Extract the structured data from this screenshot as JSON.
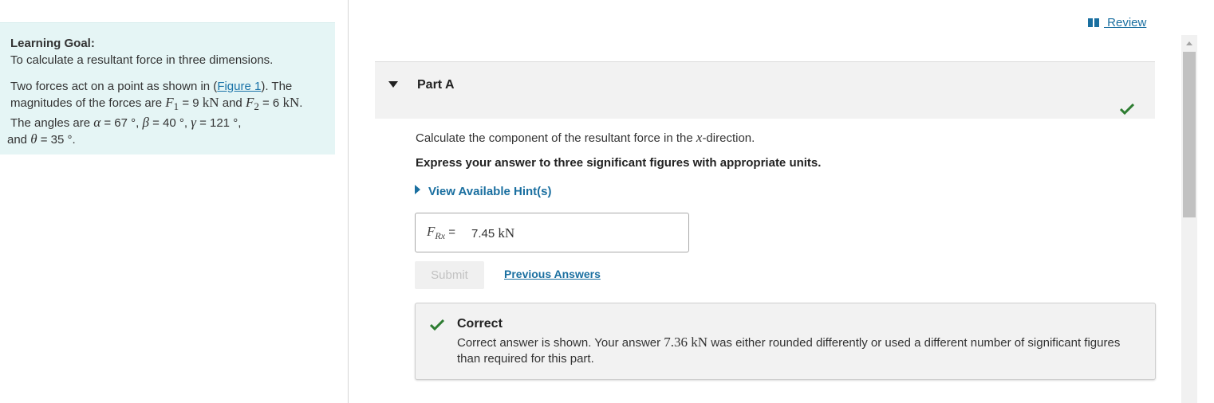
{
  "left": {
    "learning_goal_title": "Learning Goal:",
    "learning_goal_text": "To calculate a resultant force in three dimensions.",
    "problem": {
      "intro": "Two forces act on a point as shown in (",
      "figure_link": "Figure 1",
      "after_link": "). The magnitudes of the forces are ",
      "f1_sym": "F",
      "f1_sub": "1",
      "f1_eq": " = 9 ",
      "unit_kn": "kN",
      "and1": " and ",
      "f2_sym": "F",
      "f2_sub": "2",
      "f2_eq": " = 6 ",
      "unit_kn2": "kN",
      "angles_intro": ". The angles are  ",
      "alpha_sym": "α",
      "alpha_val": " = 67 °, ",
      "beta_sym": "β",
      "beta_val": " = 40 °, ",
      "gamma_sym": "γ",
      "gamma_val": " = 121 °,",
      "and2": " and ",
      "theta_sym": "θ",
      "theta_val": " = 35 °."
    }
  },
  "review": {
    "label": " Review",
    "icon": "book-icon"
  },
  "part": {
    "title": "Part A",
    "question_prefix": "Calculate the component of the resultant force in the ",
    "question_var": "x",
    "question_suffix": "-direction.",
    "instruction": "Express your answer to three significant figures with appropriate units.",
    "hints_label": "View Available Hint(s)",
    "answer": {
      "label_sym": "F",
      "label_sub": "Rx",
      "label_eq": " = ",
      "value": "7.45",
      "unit": "kN"
    },
    "submit_label": "Submit",
    "previous_answers_label": "Previous Answers",
    "feedback": {
      "title": "Correct",
      "text_before": "Correct answer is shown. Your answer ",
      "your_answer": "7.36 kN",
      "text_after": " was either rounded differently or used a different number of significant figures than required for this part."
    }
  },
  "colors": {
    "accent": "#1a6fa0",
    "success": "#2e7d32",
    "panel_bg": "#e5f5f5"
  }
}
